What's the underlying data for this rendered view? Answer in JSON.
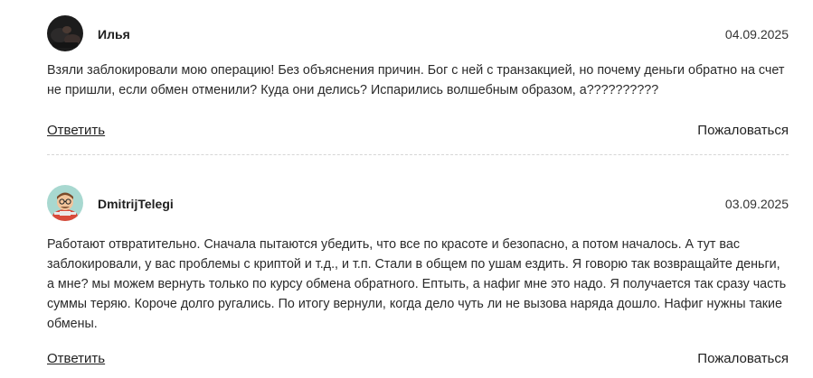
{
  "reviews": [
    {
      "author": "Илья",
      "date": "04.09.2025",
      "avatar": "dark-photo-avatar",
      "text": "Взяли заблокировали мою операцию! Без объяснения причин. Бог с ней с транзакцией, но почему деньги обратно на счет не пришли, если обмен отменили? Куда они делись? Испарились волшебным образом, а??????????",
      "reply_label": "Ответить",
      "report_label": "Пожаловаться"
    },
    {
      "author": "DmitrijTelegi",
      "date": "03.09.2025",
      "avatar": "cartoon-man-avatar",
      "text": "Работают отвратительно. Сначала пытаются убедить, что все по красоте и безопасно, а потом началось. А тут вас заблокировали, у вас проблемы с криптой и т.д., и т.п. Стали в общем по ушам ездить. Я говорю так возвращайте деньги, а мне? мы можем вернуть только по курсу обмена обратного. Ептыть, а нафиг мне это надо. Я получается так сразу часть суммы теряю. Короче долго ругались. По итогу вернули, когда дело чуть ли не вызова наряда дошло. Нафиг нужны такие обмены.",
      "reply_label": "Ответить",
      "report_label": "Пожаловаться"
    }
  ],
  "colors": {
    "text": "#1f1f1f",
    "divider": "#d6d6d6",
    "avatar_bg_1": "#1c1c1c",
    "avatar_bg_2": "#a8d8d0"
  }
}
